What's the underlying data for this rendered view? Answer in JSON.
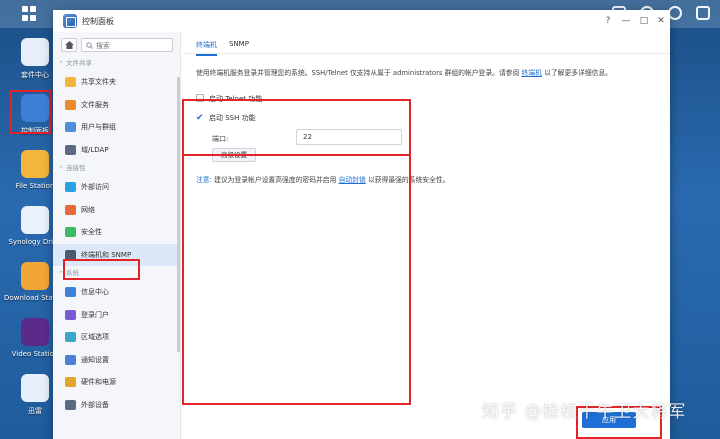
{
  "window": {
    "title": "控制面板",
    "controls": [
      "?",
      "—",
      "□",
      "✕"
    ]
  },
  "desktop": {
    "icons": [
      {
        "label": "套件中心",
        "color": "#e8eef8"
      },
      {
        "label": "控制面板",
        "color": "#3d7fd6"
      },
      {
        "label": "File Station",
        "color": "#f3b53b"
      },
      {
        "label": "Synology Drive",
        "color": "#e9f2fb"
      },
      {
        "label": "Download Station",
        "color": "#f1a636"
      },
      {
        "label": "Video Station",
        "color": "#5b2b8c"
      },
      {
        "label": "迅雷",
        "color": "#e6f0fb"
      }
    ]
  },
  "sidebar": {
    "search_placeholder": "搜索",
    "sections": [
      {
        "label": "文件共享",
        "items": [
          {
            "label": "共享文件夹",
            "icon": "folder-share-icon",
            "color": "#f3b53b"
          },
          {
            "label": "文件服务",
            "icon": "file-services-icon",
            "color": "#e98a2b"
          },
          {
            "label": "用户与群组",
            "icon": "users-icon",
            "color": "#4d8fd6"
          },
          {
            "label": "域/LDAP",
            "icon": "ldap-icon",
            "color": "#5a6a80"
          }
        ]
      },
      {
        "label": "连接性",
        "items": [
          {
            "label": "外部访问",
            "icon": "globe-icon",
            "color": "#2aa4e0"
          },
          {
            "label": "网络",
            "icon": "network-icon",
            "color": "#e7673a"
          },
          {
            "label": "安全性",
            "icon": "shield-icon",
            "color": "#3dbb6a"
          },
          {
            "label": "终端机和 SNMP",
            "icon": "terminal-icon",
            "color": "#4a5a70",
            "active": true
          }
        ]
      },
      {
        "label": "系统",
        "items": [
          {
            "label": "信息中心",
            "icon": "info-icon",
            "color": "#3b82d8"
          },
          {
            "label": "登录门户",
            "icon": "login-portal-icon",
            "color": "#7a5ad0"
          },
          {
            "label": "区域选项",
            "icon": "region-icon",
            "color": "#3aa7c9"
          },
          {
            "label": "通知设置",
            "icon": "notification-icon",
            "color": "#4a7fd2"
          },
          {
            "label": "硬件和电源",
            "icon": "hardware-power-icon",
            "color": "#e0a52a"
          },
          {
            "label": "外部设备",
            "icon": "external-device-icon",
            "color": "#5a6a80"
          }
        ]
      }
    ]
  },
  "main": {
    "tabs": [
      "终端机",
      "SNMP"
    ],
    "description_prefix": "使用终端机服务登录并管理您的系统。SSH/Telnet 仅支持从属于 administrators 群组的帐户登录。请参阅",
    "description_link": "终端机",
    "description_suffix": "以了解更多详细信息。",
    "telnet_label": "启动 Telnet 功能",
    "ssh_label": "启动 SSH 功能",
    "port_label": "端口:",
    "port_value": "22",
    "advanced_button": "高级设置",
    "note_lead": "注意:",
    "note_text": "建议为登录帐户设置高强度的密码并启用",
    "note_link": "自动封锁",
    "note_suffix": "以获得最强的系统安全性。",
    "apply_button": "应用"
  },
  "watermark": "知乎 @检校千牛卫大将军"
}
